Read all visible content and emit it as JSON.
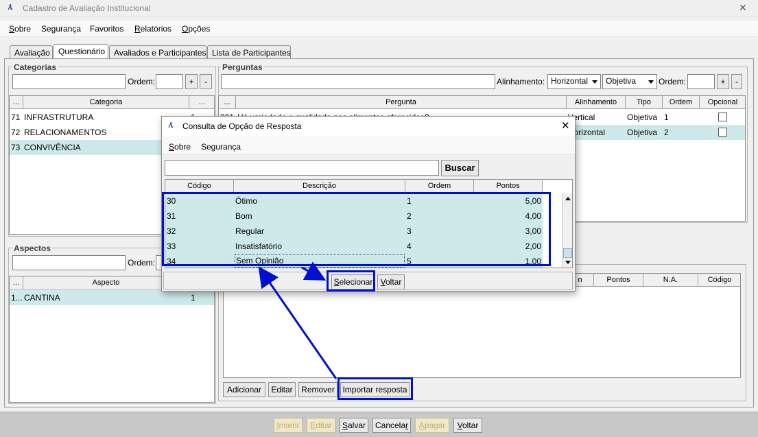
{
  "window": {
    "title": "Cadastro de Avaliação Institucional",
    "logo": "/\\.",
    "close": "✕"
  },
  "menu": {
    "sobre_prefix": "S",
    "sobre_rest": "obre",
    "seguranca": "Segurança",
    "favoritos": "Favoritos",
    "relatorios_prefix": "R",
    "relatorios_rest": "elatórios",
    "opcoes_prefix": "O",
    "opcoes_rest": "pções"
  },
  "tabs": [
    "Avaliação",
    "Questionário",
    "Avaliados e Participantes",
    "Lista de Participantes"
  ],
  "categorias": {
    "label": "Categorias",
    "ordem_label": "Ordem:",
    "plus": "+",
    "minus": "-",
    "headers": [
      "...",
      "Categoria",
      "..."
    ],
    "rows": [
      {
        "id": "71",
        "name": "INFRASTRUTURA",
        "extra": "1"
      },
      {
        "id": "72",
        "name": "RELACIONAMENTOS",
        "extra": ""
      },
      {
        "id": "73",
        "name": "CONVIVÊNCIA",
        "extra": ""
      }
    ]
  },
  "perguntas": {
    "label": "Perguntas",
    "alinhamento_label": "Alinhamento:",
    "alinhamento_value": "Horizontal",
    "tipo_value": "Objetiva",
    "ordem_label": "Ordem:",
    "plus": "+",
    "minus": "-",
    "headers": [
      "...",
      "Pergunta",
      "Alinhamento",
      "Tipo",
      "Ordem",
      "Opcional"
    ],
    "rows": [
      {
        "id": "201",
        "text": "Há variedade e qualidade nos alimentos oferecidos?",
        "alinhamento": "Vertical",
        "tipo": "Objetiva",
        "ordem": "1"
      },
      {
        "id": "",
        "text": "",
        "alinhamento": "Horizontal",
        "tipo": "Objetiva",
        "ordem": "2"
      }
    ]
  },
  "aspectos": {
    "label": "Aspectos",
    "ordem_label": "Ordem:",
    "headers": [
      "...",
      "Aspecto",
      "..."
    ],
    "rows": [
      {
        "id": "1...",
        "name": "CANTINA",
        "extra": "1"
      }
    ]
  },
  "respostas": {
    "headers": [
      "n",
      "Pontos",
      "N.A.",
      "Código"
    ],
    "buttons": {
      "adicionar": "Adicionar",
      "editar": "Editar",
      "remover": "Remover",
      "importar": "Importar resposta"
    }
  },
  "footer": {
    "inserir_prefix": "I",
    "inserir_rest": "nserir",
    "editar_prefix": "E",
    "editar_rest": "ditar",
    "salvar_prefix": "S",
    "salvar_rest": "alvar",
    "cancelar_prefix": "Cancela",
    "cancelar_rest": "r",
    "apagar_prefix": "A",
    "apagar_rest": "pagar",
    "voltar_prefix": "V",
    "voltar_rest": "oltar"
  },
  "dialog": {
    "title": "Consulta de Opção de Resposta",
    "close": "✕",
    "menu_sobre_prefix": "S",
    "menu_sobre_rest": "obre",
    "menu_seguranca": "Segurança",
    "buscar": "Buscar",
    "headers": [
      "Código",
      "Descrição",
      "Ordem",
      "Pontos"
    ],
    "rows": [
      {
        "codigo": "30",
        "descricao": "Ótimo",
        "ordem": "1",
        "pontos": "5,00"
      },
      {
        "codigo": "31",
        "descricao": "Bom",
        "ordem": "2",
        "pontos": "4,00"
      },
      {
        "codigo": "32",
        "descricao": "Regular",
        "ordem": "3",
        "pontos": "3,00"
      },
      {
        "codigo": "33",
        "descricao": "Insatisfatório",
        "ordem": "4",
        "pontos": "2,00"
      },
      {
        "codigo": "34",
        "descricao": "Sem Opinião",
        "ordem": "5",
        "pontos": "1,00"
      }
    ],
    "selecionar_prefix": "S",
    "selecionar_rest": "elecionar",
    "voltar_prefix": "V",
    "voltar_rest": "oltar"
  },
  "colors": {
    "selection": "#cde9ea",
    "annotation": "#0010d0"
  }
}
